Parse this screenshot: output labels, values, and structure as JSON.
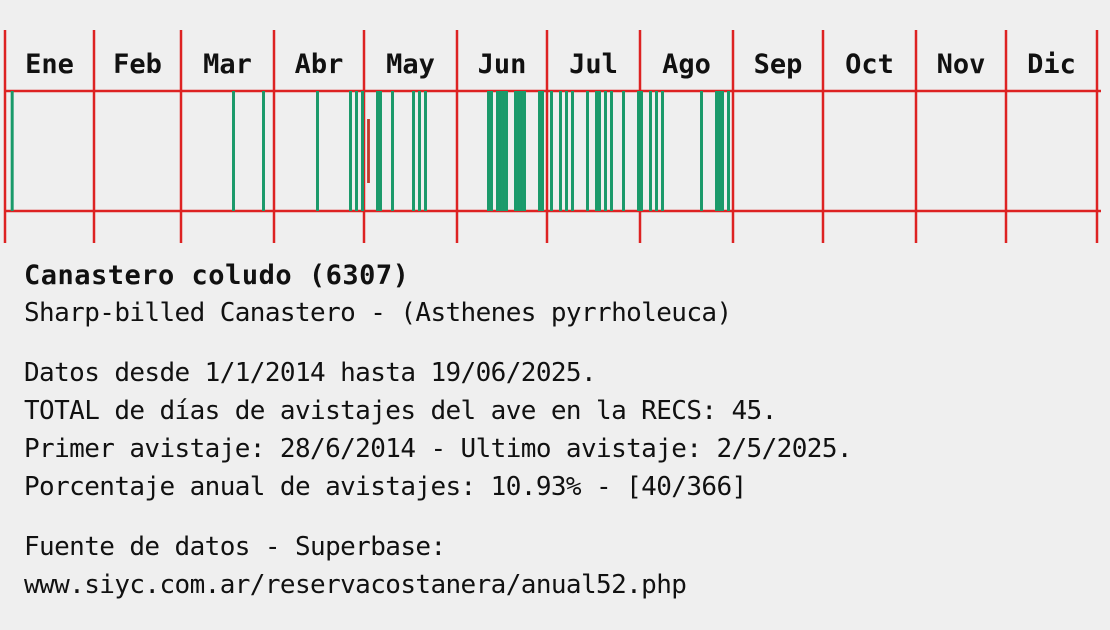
{
  "chart_data": {
    "type": "bar",
    "months": [
      "Ene",
      "Feb",
      "Mar",
      "Abr",
      "May",
      "Jun",
      "Jul",
      "Ago",
      "Sep",
      "Oct",
      "Nov",
      "Dic"
    ],
    "days_in_year": 366,
    "sighting_day_of_year": [
      3,
      78,
      88,
      106,
      117,
      119,
      121,
      126,
      127,
      131,
      138,
      140,
      142,
      163,
      164,
      166,
      167,
      168,
      169,
      172,
      173,
      174,
      175,
      180,
      181,
      184,
      187,
      189,
      191,
      196,
      199,
      200,
      202,
      204,
      208,
      213,
      214,
      217,
      219,
      221,
      234,
      239,
      240,
      241,
      243
    ],
    "highlight_day_of_year": [
      123
    ],
    "colors": {
      "grid": "#dd2222",
      "sighting": "#1a9a6a",
      "highlight": "#c0392b",
      "background": "#efefef"
    }
  },
  "info": {
    "title": "Canastero coludo (6307)",
    "subtitle": "Sharp-billed Canastero - (Asthenes pyrrholeuca)",
    "lines": [
      "Datos desde 1/1/2014 hasta 19/06/2025.",
      "TOTAL de días de avistajes del ave en la RECS: 45.",
      "Primer avistaje: 28/6/2014 - Ultimo avistaje: 2/5/2025.",
      "Porcentaje anual de avistajes: 10.93% - [40/366]"
    ],
    "source_lines": [
      "Fuente de datos - Superbase:",
      "www.siyc.com.ar/reservacostanera/anual52.php"
    ]
  }
}
